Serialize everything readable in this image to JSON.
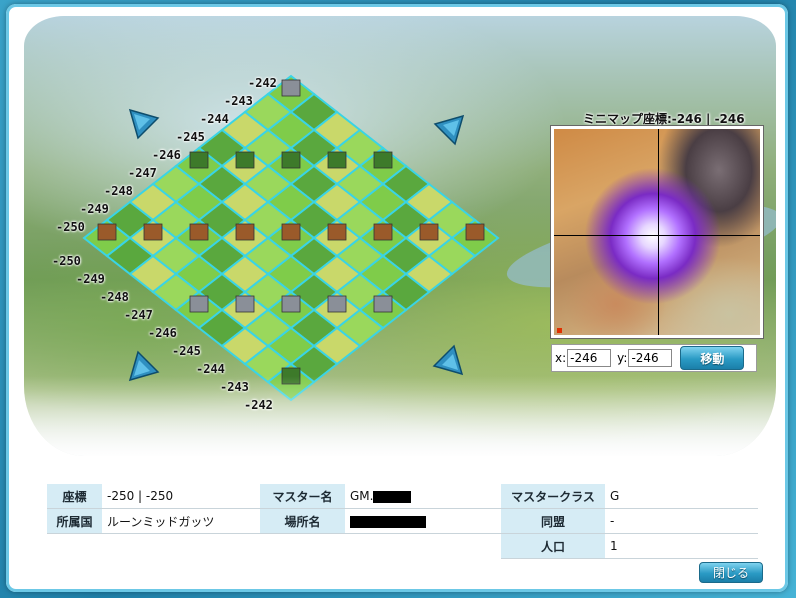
{
  "map": {
    "top_left_labels": [
      "-242",
      "-243",
      "-244",
      "-245",
      "-246",
      "-247",
      "-248",
      "-249",
      "-250"
    ],
    "bottom_left_labels": [
      "-250",
      "-249",
      "-248",
      "-247",
      "-246",
      "-245",
      "-244",
      "-243",
      "-242"
    ],
    "scroll_arrows": [
      "arrow-up-left-icon",
      "arrow-up-right-icon",
      "arrow-down-left-icon",
      "arrow-down-right-icon"
    ],
    "tile_colors": [
      "#7fcc4a",
      "#9ad85c",
      "#c9d86a",
      "#5aa83e"
    ]
  },
  "minimap": {
    "title": "ミニマップ座標:-246 | -246",
    "x_label": "x:",
    "x_value": "-246",
    "y_label": "y:",
    "y_value": "-246",
    "move_label": "移動"
  },
  "info": {
    "coord_label": "座標",
    "coord_value": "-250 | -250",
    "master_name_label": "マスター名",
    "master_name_value": "GM.",
    "master_class_label": "マスタークラス",
    "master_class_value": "G",
    "nation_label": "所属国",
    "nation_value": "ルーンミッドガッツ",
    "place_label": "場所名",
    "alliance_label": "同盟",
    "alliance_value": "-",
    "population_label": "人口",
    "population_value": "1"
  },
  "close_label": "閉じる",
  "colors": {
    "accent": "#2a9ac4",
    "header_cell": "#d6ecf5",
    "frame_border": "#6cc8e6"
  }
}
